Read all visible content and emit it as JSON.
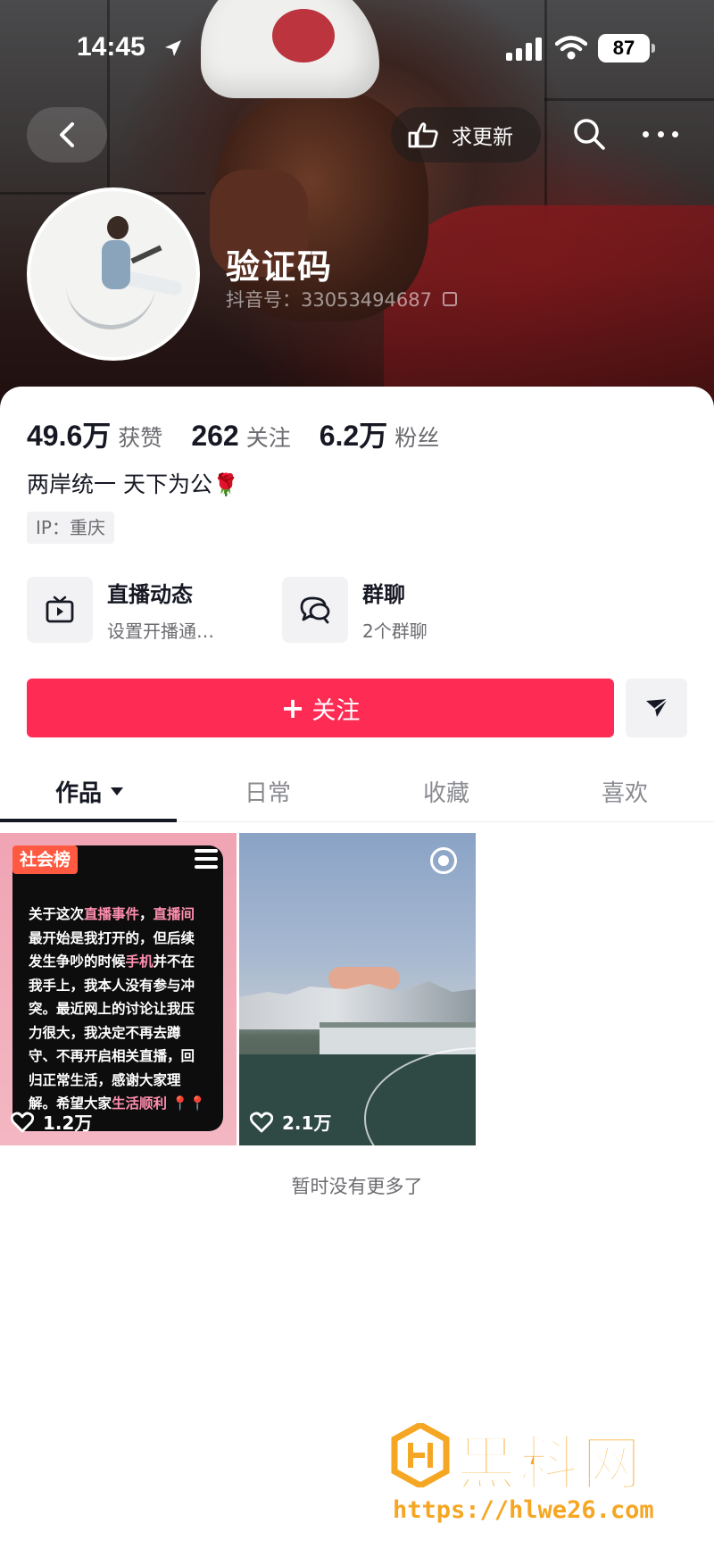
{
  "status_bar": {
    "time": "14:45",
    "battery": "87"
  },
  "nav": {
    "request_update_label": "求更新"
  },
  "profile": {
    "name": "验证码",
    "douyin_id": "抖音号：33053494687",
    "bio": "两岸统一 天下为公",
    "bio_emoji": "🌹",
    "ip": "IP：重庆"
  },
  "stats": [
    {
      "value": "49.6万",
      "label": "获赞"
    },
    {
      "value": "262",
      "label": "关注"
    },
    {
      "value": "6.2万",
      "label": "粉丝"
    }
  ],
  "features": [
    {
      "title": "直播动态",
      "subtitle": "设置开播通…",
      "icon": "tv-icon"
    },
    {
      "title": "群聊",
      "subtitle": "2个群聊",
      "icon": "group-chat-icon"
    }
  ],
  "actions": {
    "follow_label": "关注",
    "follow_plus": "+"
  },
  "tabs": [
    {
      "label": "作品",
      "active": true
    },
    {
      "label": "日常",
      "active": false
    },
    {
      "label": "收藏",
      "active": false
    },
    {
      "label": "喜欢",
      "active": false
    }
  ],
  "videos": [
    {
      "badge": "社会榜",
      "likes": "1.2万",
      "post_parts": [
        {
          "t": "关于这次",
          "hl": false
        },
        {
          "t": "直播事件",
          "hl": true
        },
        {
          "t": "，",
          "hl": false
        },
        {
          "t": "直播间",
          "hl": true
        },
        {
          "t": "最开始是我打开的，但后续发生争吵的时候",
          "hl": false
        },
        {
          "t": "手机",
          "hl": true
        },
        {
          "t": "并不在我手上，我本人没有参与冲突。最近网上的讨论让我压力很大，我决定不再去蹲守、不再开启相关直播，回归正常生活，感谢大家理解。希望大家",
          "hl": false
        },
        {
          "t": "生活顺利",
          "hl": true
        }
      ],
      "post_pins": " 📍📍"
    },
    {
      "likes": "2.1万"
    }
  ],
  "end_note": "暂时没有更多了",
  "watermark": {
    "brand": "黑料网",
    "url": "https://hlwe26.com"
  },
  "colors": {
    "accent": "#fe2c55",
    "text": "#161823",
    "secondary": "#6b6b70",
    "watermark": "#f5a623"
  }
}
